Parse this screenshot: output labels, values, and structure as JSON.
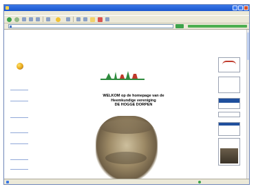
{
  "browser": {
    "window_title": "",
    "menu": [],
    "toolbar": {
      "search_label": "",
      "favorites_label": ""
    },
    "address": {
      "label": "",
      "url": "",
      "go_label": "",
      "links_label": ""
    },
    "status": {
      "left": "",
      "zone": ""
    }
  },
  "page": {
    "welcome_lines": [
      "WELKOM op de homepage van de",
      "Heemkundige vereniging",
      "DE HOGGE DORPEN"
    ],
    "nav_items": [],
    "photo_captions": [
      "",
      ""
    ],
    "banners": {
      "b1_title": "",
      "b2_title": "",
      "b4_title": ""
    }
  },
  "colors": {
    "accent_blue": "#1a56cf",
    "link_blue": "#2244aa",
    "logo_green": "#2e8b3d",
    "logo_red": "#c0392b"
  }
}
